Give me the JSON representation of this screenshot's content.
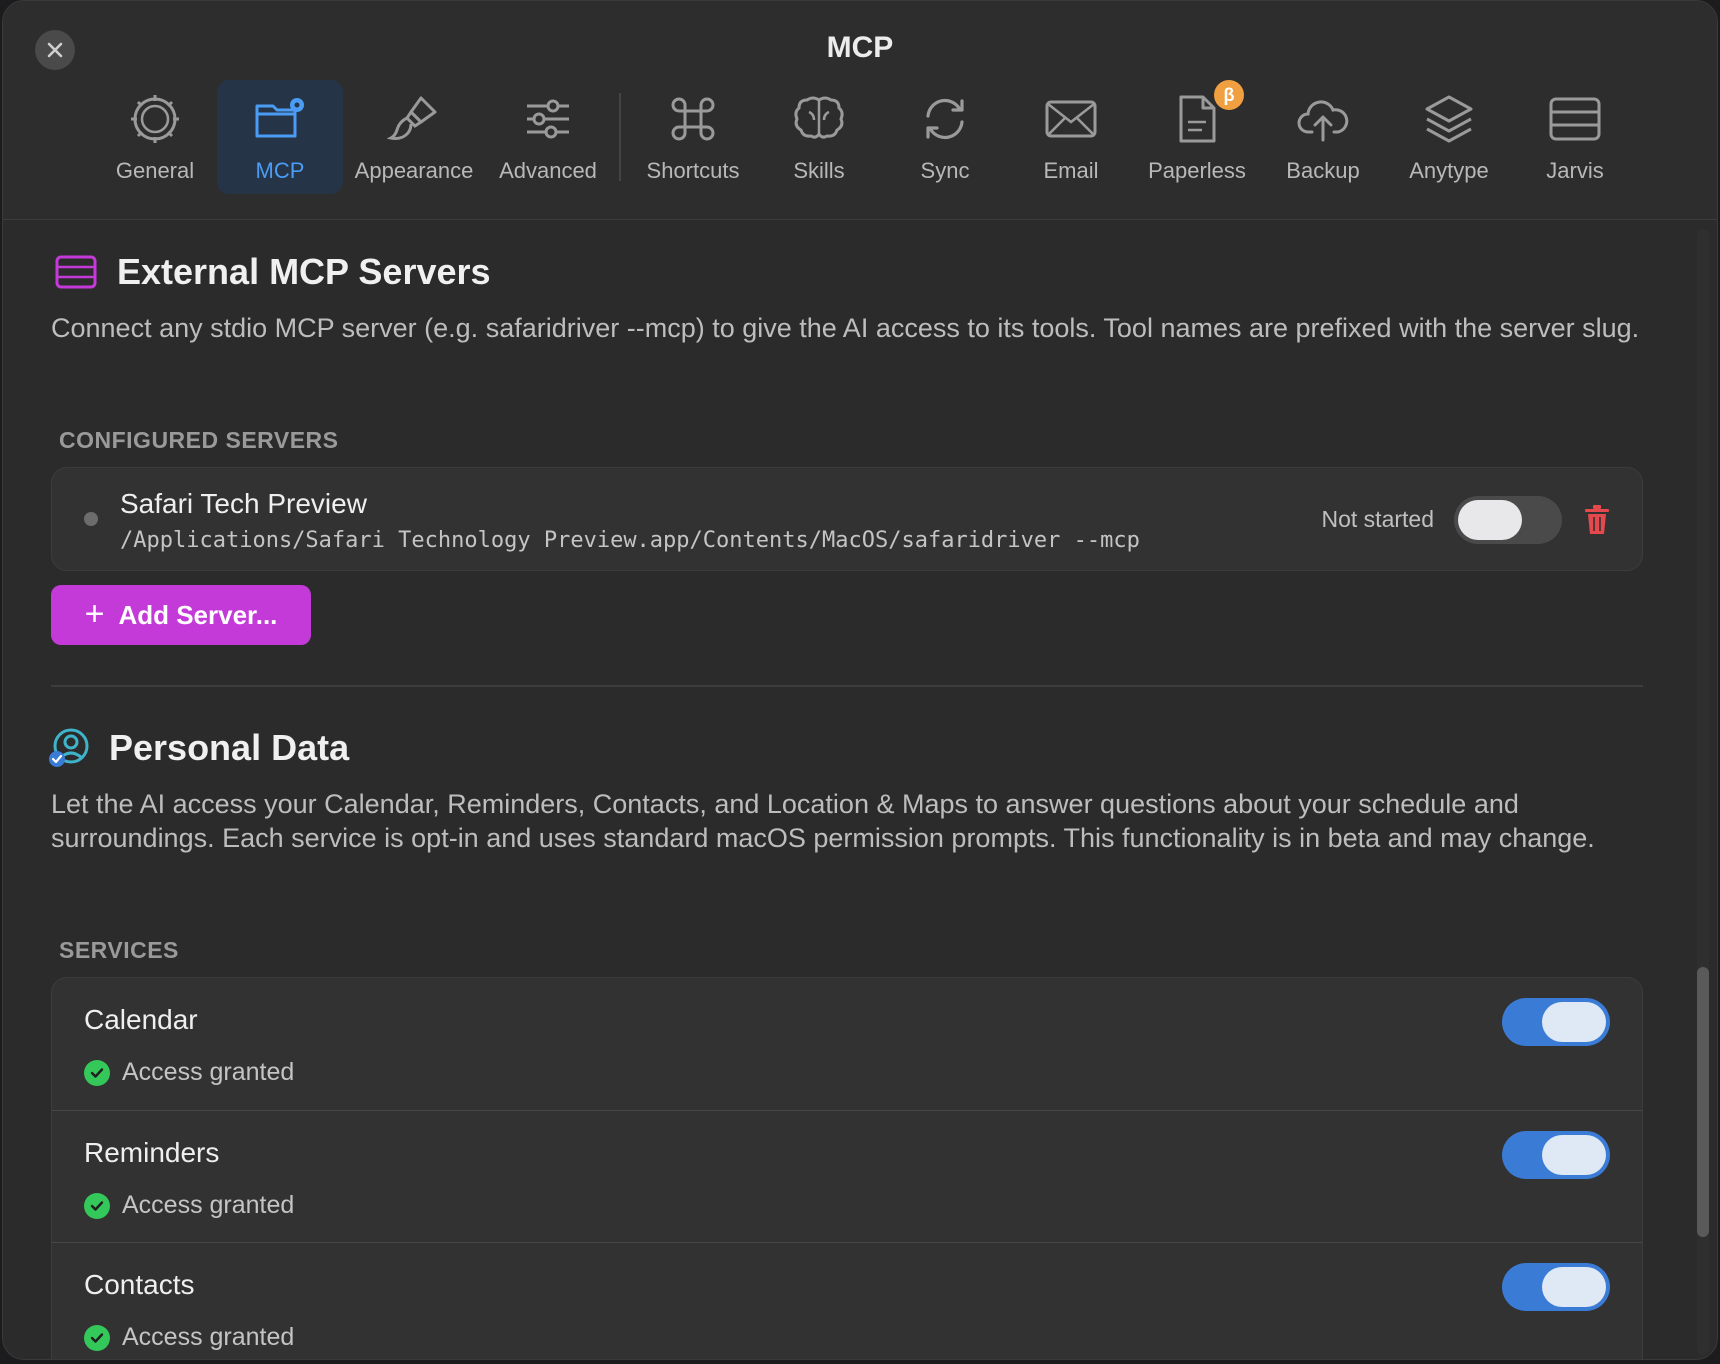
{
  "window": {
    "title": "MCP"
  },
  "toolbar": {
    "tabs": [
      {
        "label": "General",
        "icon": "gear-icon"
      },
      {
        "label": "MCP",
        "icon": "folder-gear-icon",
        "active": true
      },
      {
        "label": "Appearance",
        "icon": "paintbrush-icon"
      },
      {
        "label": "Advanced",
        "icon": "sliders-icon"
      },
      {
        "label": "Shortcuts",
        "icon": "command-icon"
      },
      {
        "label": "Skills",
        "icon": "brain-icon"
      },
      {
        "label": "Sync",
        "icon": "sync-icon"
      },
      {
        "label": "Email",
        "icon": "envelope-icon"
      },
      {
        "label": "Paperless",
        "icon": "document-icon",
        "badge": "β"
      },
      {
        "label": "Backup",
        "icon": "cloud-upload-icon"
      },
      {
        "label": "Anytype",
        "icon": "layers-icon"
      },
      {
        "label": "Jarvis",
        "icon": "server-rack-icon"
      }
    ]
  },
  "external": {
    "title": "External MCP Servers",
    "description": "Connect any stdio MCP server (e.g. safaridriver --mcp) to give the AI access to its tools. Tool names are prefixed with the server slug.",
    "group_label": "CONFIGURED SERVERS",
    "servers": [
      {
        "name": "Safari Tech Preview",
        "command": "/Applications/Safari Technology Preview.app/Contents/MacOS/safaridriver --mcp",
        "status": "Not started",
        "enabled": false
      }
    ],
    "add_button": "Add Server..."
  },
  "personal": {
    "title": "Personal Data",
    "description": "Let the AI access your Calendar, Reminders, Contacts, and Location & Maps to answer questions about your schedule and surroundings. Each service is opt-in and uses standard macOS permission prompts. This functionality is in beta and may change.",
    "group_label": "SERVICES",
    "services": [
      {
        "name": "Calendar",
        "status": "Access granted",
        "enabled": true
      },
      {
        "name": "Reminders",
        "status": "Access granted",
        "enabled": true
      },
      {
        "name": "Contacts",
        "status": "Access granted",
        "enabled": true
      }
    ]
  },
  "colors": {
    "accent_blue": "#3a7bd5",
    "accent_purple": "#c43ad8",
    "success_green": "#34c759",
    "danger_red": "#e5484d"
  }
}
